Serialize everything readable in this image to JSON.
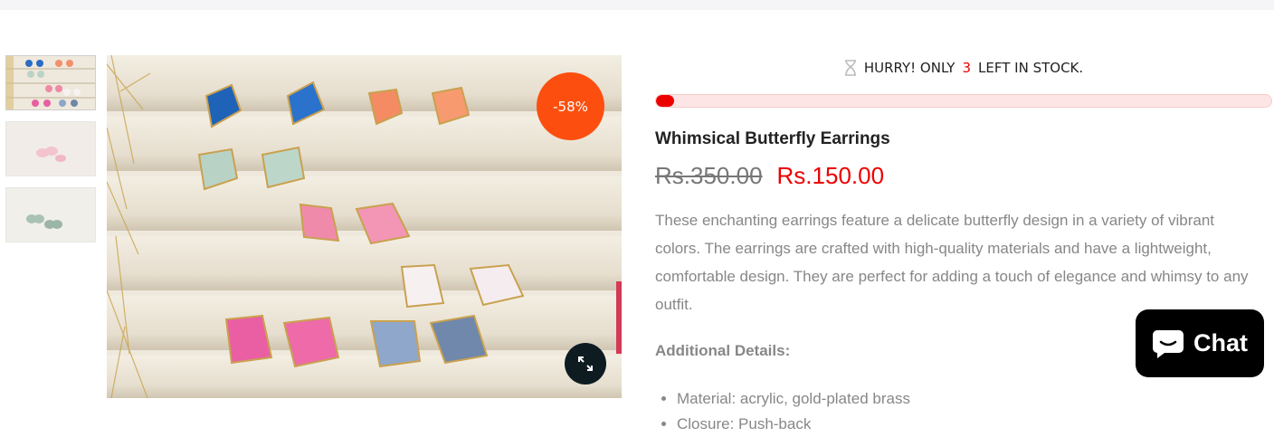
{
  "product": {
    "title": "Whimsical Butterfly Earrings",
    "old_price": "Rs.350.00",
    "new_price": "Rs.150.00",
    "discount_badge": "-58%",
    "description": "These enchanting earrings feature a delicate butterfly design in a variety of vibrant colors. The earrings are crafted with high-quality materials and have a lightweight, comfortable design. They are perfect for adding a touch of elegance and whimsy to any outfit.",
    "additional_title": "Additional Details:",
    "specs": [
      "Material: acrylic, gold-plated brass",
      "Closure: Push-back"
    ]
  },
  "stock": {
    "prefix": "HURRY! ONLY",
    "count": "3",
    "suffix": "LEFT IN STOCK.",
    "progress_percent": 3
  },
  "chat": {
    "label": "Chat"
  },
  "colors": {
    "accent_red": "#ec0101",
    "badge_orange": "#fc4f0f",
    "zoom_button": "#0e1c22",
    "chat_bg": "#000000"
  },
  "icons": {
    "stock": "hourglass-icon",
    "zoom": "expand-icon",
    "chat": "chat-bubble-icon"
  }
}
